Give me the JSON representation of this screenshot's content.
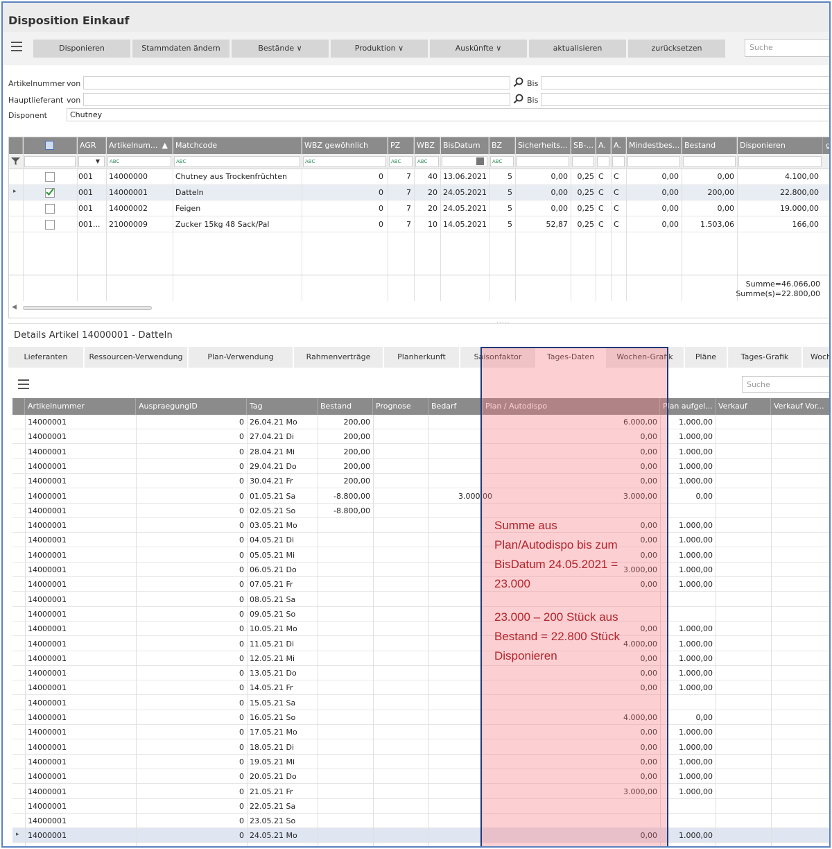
{
  "window": {
    "title": "Disposition Einkauf"
  },
  "toolbar": {
    "buttons": [
      "Disponieren",
      "Stammdaten ändern",
      "Bestände ∨",
      "Produktion ∨",
      "Auskünfte ∨",
      "aktualisieren",
      "zurücksetzen"
    ],
    "search_placeholder": "Suche"
  },
  "filters": {
    "artikelnummer_label": "Artikelnummer",
    "von1": "von",
    "bis1": "Bis",
    "hauptlieferant_label": "Hauptlieferant",
    "von2": "von",
    "bis2": "Bis",
    "disponent_label": "Disponent",
    "disponent_value": "Chutney"
  },
  "grid1": {
    "headers": [
      "AGR",
      "Artikelnum...",
      "Matchcode",
      "WBZ gewöhnlich",
      "PZ",
      "WBZ",
      "BisDatum",
      "BZ",
      "Sicherheits...",
      "SB-...",
      "A.",
      "A.",
      "Mindestbes...",
      "Bestand",
      "Disponieren",
      "g"
    ],
    "rows": [
      {
        "checked": false,
        "agr": "001",
        "art": "14000000",
        "match": "Chutney aus Trockenfrüchten",
        "wbzg": "0",
        "pz": "7",
        "wbz": "40",
        "bis": "13.06.2021",
        "bz": "5",
        "sich": "0,00",
        "sb": "0,25",
        "a1": "C",
        "a2": "C",
        "mind": "0,00",
        "best": "0,00",
        "disp": "4.100,00"
      },
      {
        "checked": true,
        "agr": "001",
        "art": "14000001",
        "match": "Datteln",
        "wbzg": "0",
        "pz": "7",
        "wbz": "20",
        "bis": "24.05.2021",
        "bz": "5",
        "sich": "0,00",
        "sb": "0,25",
        "a1": "C",
        "a2": "C",
        "mind": "0,00",
        "best": "200,00",
        "disp": "22.800,00"
      },
      {
        "checked": false,
        "agr": "001",
        "art": "14000002",
        "match": "Feigen",
        "wbzg": "0",
        "pz": "7",
        "wbz": "20",
        "bis": "24.05.2021",
        "bz": "5",
        "sich": "0,00",
        "sb": "0,25",
        "a1": "C",
        "a2": "C",
        "mind": "0,00",
        "best": "0,00",
        "disp": "19.000,00"
      },
      {
        "checked": false,
        "agr": "001...",
        "art": "21000009",
        "match": "Zucker 15kg 48 Sack/Pal",
        "wbzg": "0",
        "pz": "7",
        "wbz": "10",
        "bis": "14.05.2021",
        "bz": "5",
        "sich": "52,87",
        "sb": "0,25",
        "a1": "C",
        "a2": "C",
        "mind": "0,00",
        "best": "1.503,06",
        "disp": "166,00"
      }
    ],
    "sum1": "Summe=46.066,00",
    "sum2": "Summe(s)=22.800,00"
  },
  "details": {
    "title": "Details Artikel 14000001 - Datteln",
    "tabs": [
      "Lieferanten",
      "Ressourcen-Verwendung",
      "Plan-Verwendung",
      "Rahmenverträge",
      "Planherkunft",
      "Saisonfaktor",
      "Tages-Daten",
      "Wochen-Grafik",
      "Pläne",
      "Tages-Grafik",
      "Woch"
    ],
    "active_tab": "Tages-Daten",
    "search_placeholder": "Suche"
  },
  "grid2": {
    "headers": [
      "Artikelnummer",
      "AuspraegungID",
      "Tag",
      "Bestand",
      "Prognose",
      "Bedarf",
      "Plan / Autodispo",
      "Plan aufgel...",
      "Verkauf",
      "Verkauf Vor..."
    ],
    "rows": [
      [
        "14000001",
        "0",
        "26.04.21 Mo",
        "200,00",
        "",
        "",
        "6.000,00",
        "1.000,00"
      ],
      [
        "14000001",
        "0",
        "27.04.21 Di",
        "200,00",
        "",
        "",
        "0,00",
        "1.000,00"
      ],
      [
        "14000001",
        "0",
        "28.04.21 Mi",
        "200,00",
        "",
        "",
        "0,00",
        "1.000,00"
      ],
      [
        "14000001",
        "0",
        "29.04.21 Do",
        "200,00",
        "",
        "",
        "0,00",
        "1.000,00"
      ],
      [
        "14000001",
        "0",
        "30.04.21 Fr",
        "200,00",
        "",
        "",
        "0,00",
        "1.000,00"
      ],
      [
        "14000001",
        "0",
        "01.05.21 Sa",
        "-8.800,00",
        "",
        "3.000,00",
        "3.000,00",
        "0,00"
      ],
      [
        "14000001",
        "0",
        "02.05.21 So",
        "-8.800,00",
        "",
        "",
        "",
        ""
      ],
      [
        "14000001",
        "0",
        "03.05.21 Mo",
        "",
        "",
        "",
        "0,00",
        "1.000,00"
      ],
      [
        "14000001",
        "0",
        "04.05.21 Di",
        "",
        "",
        "",
        "0,00",
        "1.000,00"
      ],
      [
        "14000001",
        "0",
        "05.05.21 Mi",
        "",
        "",
        "",
        "0,00",
        "1.000,00"
      ],
      [
        "14000001",
        "0",
        "06.05.21 Do",
        "",
        "",
        "",
        "3.000,00",
        "1.000,00"
      ],
      [
        "14000001",
        "0",
        "07.05.21 Fr",
        "",
        "",
        "",
        "0,00",
        "1.000,00"
      ],
      [
        "14000001",
        "0",
        "08.05.21 Sa",
        "",
        "",
        "",
        "",
        ""
      ],
      [
        "14000001",
        "0",
        "09.05.21 So",
        "",
        "",
        "",
        "",
        ""
      ],
      [
        "14000001",
        "0",
        "10.05.21 Mo",
        "",
        "",
        "",
        "0,00",
        "1.000,00"
      ],
      [
        "14000001",
        "0",
        "11.05.21 Di",
        "",
        "",
        "",
        "4.000,00",
        "1.000,00"
      ],
      [
        "14000001",
        "0",
        "12.05.21 Mi",
        "",
        "",
        "",
        "0,00",
        "1.000,00"
      ],
      [
        "14000001",
        "0",
        "13.05.21 Do",
        "",
        "",
        "",
        "0,00",
        "1.000,00"
      ],
      [
        "14000001",
        "0",
        "14.05.21 Fr",
        "",
        "",
        "",
        "0,00",
        "1.000,00"
      ],
      [
        "14000001",
        "0",
        "15.05.21 Sa",
        "",
        "",
        "",
        "",
        ""
      ],
      [
        "14000001",
        "0",
        "16.05.21 So",
        "",
        "",
        "",
        "4.000,00",
        "0,00"
      ],
      [
        "14000001",
        "0",
        "17.05.21 Mo",
        "",
        "",
        "",
        "0,00",
        "1.000,00"
      ],
      [
        "14000001",
        "0",
        "18.05.21 Di",
        "",
        "",
        "",
        "0,00",
        "1.000,00"
      ],
      [
        "14000001",
        "0",
        "19.05.21 Mi",
        "",
        "",
        "",
        "0,00",
        "1.000,00"
      ],
      [
        "14000001",
        "0",
        "20.05.21 Do",
        "",
        "",
        "",
        "0,00",
        "1.000,00"
      ],
      [
        "14000001",
        "0",
        "21.05.21 Fr",
        "",
        "",
        "",
        "3.000,00",
        "1.000,00"
      ],
      [
        "14000001",
        "0",
        "22.05.21 Sa",
        "",
        "",
        "",
        "",
        ""
      ],
      [
        "14000001",
        "0",
        "23.05.21 So",
        "",
        "",
        "",
        "",
        ""
      ],
      [
        "14000001",
        "0",
        "24.05.21 Mo",
        "",
        "",
        "",
        "0,00",
        "1.000,00"
      ]
    ]
  },
  "annotation": {
    "lines1": [
      "Summe aus",
      "Plan/Autodispo bis zum",
      "BisDatum 24.05.2021 =",
      "23.000"
    ],
    "lines2": [
      "23.000 – 200 Stück aus",
      "Bestand = 22.800 Stück",
      "Disponieren"
    ],
    "color": "#b1232a"
  }
}
